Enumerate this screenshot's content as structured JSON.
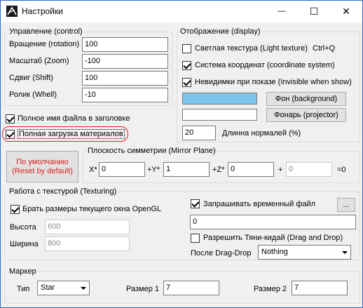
{
  "window": {
    "title": "Настройки",
    "minimize_glyph": "—",
    "maximize_glyph": "☐",
    "close_glyph": "✕"
  },
  "control": {
    "group_label": "Управление (control)",
    "rotation_label": "Вращение (rotation)",
    "rotation_value": "100",
    "zoom_label": "Масштаб (Zoom)",
    "zoom_value": "-100",
    "shift_label": "Сдвиг (Shift)",
    "shift_value": "100",
    "wheel_label": "Ролик (Whell)",
    "wheel_value": "-10"
  },
  "checks": {
    "full_filename_label": "Полное имя файла в заголовке",
    "full_filename_checked": true,
    "full_load_label": "Полная загрузка материалов",
    "full_load_checked": true
  },
  "display": {
    "group_label": "Отображение (display)",
    "light_texture_label": "Светлая текстура (Light texture)",
    "light_texture_shortcut": "Ctrl+Q",
    "light_texture_checked": false,
    "coord_system_label": "Система координат (coordinate system)",
    "coord_system_checked": true,
    "invisible_label": "Невидимки при показе (Invisible when show)",
    "invisible_checked": true,
    "background_button": "Фон (background)",
    "background_color": "#7bc4ec",
    "projector_button": "Фонарь (projector)",
    "projector_color": "#ffffff",
    "normals_value": "20",
    "normals_label": "Длинна нормалей (%)"
  },
  "reset_button": {
    "line1": "По умолчанию",
    "line2": "(Reset by default)",
    "color": "#e02020"
  },
  "mirror": {
    "group_label": "Плоскость симметрии (Mirror Plane)",
    "x_label": "X*",
    "x_value": "0",
    "y_label": "+Y*",
    "y_value": "1",
    "z_label": "+Z*",
    "z_value": "0",
    "plus_label": "+",
    "d_value": "0",
    "eq_label": "=0"
  },
  "texturing": {
    "group_label": "Работа с текстурой (Texturing)",
    "window_size_label": "Брать размеры текущего окна OpenGL",
    "window_size_checked": true,
    "height_label": "Высота",
    "height_value": "600",
    "width_label": "Ширина",
    "width_value": "800",
    "temp_file_label": "Запрашивать временный файл",
    "temp_file_checked": true,
    "browse_button": "...",
    "temp_file_value": "0",
    "drag_drop_label": "Разрешить Тяни-кидай (Drag and Drop)",
    "drag_drop_checked": false,
    "after_dd_label": "После Drag-Drop",
    "after_dd_value": "Nothing"
  },
  "marker": {
    "group_label": "Маркер",
    "type_label": "Тип",
    "type_value": "Star",
    "size1_label": "Размер 1",
    "size1_value": "7",
    "size2_label": "Размер 2",
    "size2_value": "7"
  }
}
